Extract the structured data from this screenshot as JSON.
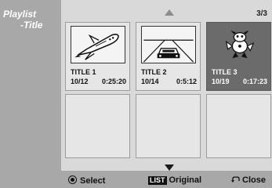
{
  "side_menu": {
    "line1": "Playlist",
    "line2": "-Title"
  },
  "page_indicator": "3/3",
  "titles": [
    {
      "name": "TITLE 1",
      "date": "10/12",
      "duration": "0:25:20",
      "thumbnail": "space-shuttle"
    },
    {
      "name": "TITLE 2",
      "date": "10/14",
      "duration": "0:5:12",
      "thumbnail": "car-on-road"
    },
    {
      "name": "TITLE 3",
      "date": "10/19",
      "duration": "0:17:23",
      "thumbnail": "cartoon-character",
      "selected": true
    }
  ],
  "footer": {
    "select_label": "Select",
    "list_key": "LIST",
    "original_label": "Original",
    "close_label": "Close"
  },
  "icons": {
    "up": "arrow-up-icon",
    "down": "arrow-down-icon",
    "select": "enter-button-icon",
    "return": "return-icon"
  }
}
